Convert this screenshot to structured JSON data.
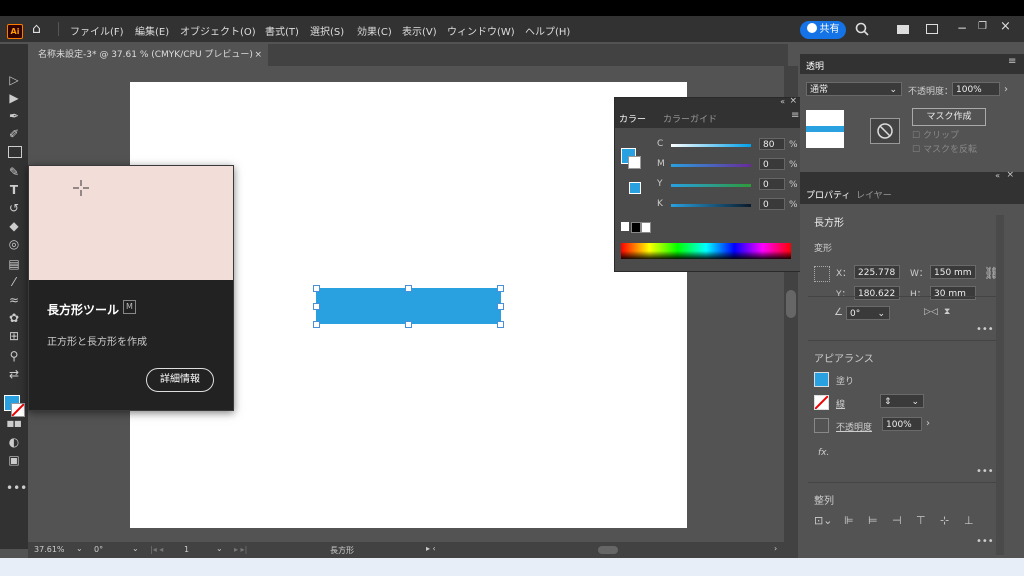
{
  "menu": {
    "app_logo": "Ai",
    "items": [
      "ファイル(F)",
      "編集(E)",
      "オブジェクト(O)",
      "書式(T)",
      "選択(S)",
      "効果(C)",
      "表示(V)",
      "ウィンドウ(W)",
      "ヘルプ(H)"
    ],
    "share_label": "共有"
  },
  "document_tab": {
    "title": "名称未設定-3* @ 37.61 % (CMYK/CPU プレビュー)",
    "close": "×"
  },
  "tooltip": {
    "title": "長方形ツール",
    "shortcut": "M",
    "description": "正方形と長方形を作成",
    "button": "詳細情報"
  },
  "color_panel": {
    "tab_color": "カラー",
    "tab_guide": "カラーガイド",
    "sliders": [
      {
        "label": "C",
        "value": "80"
      },
      {
        "label": "M",
        "value": "0"
      },
      {
        "label": "Y",
        "value": "0"
      },
      {
        "label": "K",
        "value": "0"
      }
    ],
    "unit": "%"
  },
  "transparency_panel": {
    "tab": "透明",
    "blend_mode": "通常",
    "opacity_label": "不透明度：",
    "opacity_value": "100%",
    "mask_button": "マスク作成",
    "clip_label": "クリップ",
    "invert_label": "マスクを反転"
  },
  "properties_panel": {
    "tab_properties": "プロパティ",
    "tab_layers": "レイヤー",
    "object_type": "長方形",
    "transform_label": "変形",
    "x_label": "X：",
    "x_value": "225.778",
    "y_label": "Y：",
    "y_value": "180.622",
    "w_label": "W：",
    "w_value": "150 mm",
    "h_label": "H：",
    "h_value": "30 mm",
    "angle_value": "0°",
    "appearance_label": "アピアランス",
    "fill_label": "塗り",
    "stroke_label": "線",
    "opacity_label": "不透明度",
    "opacity_value": "100%",
    "fx_label": "fx.",
    "align_label": "整列",
    "more": "•••"
  },
  "status_bar": {
    "zoom": "37.61%",
    "rotation": "0°",
    "artboard_num": "1",
    "tool_name": "長方形"
  },
  "colors": {
    "accent_blue": "#29a0e0",
    "share_blue": "#1473e6",
    "tooltip_preview": "#f2ddd8"
  }
}
